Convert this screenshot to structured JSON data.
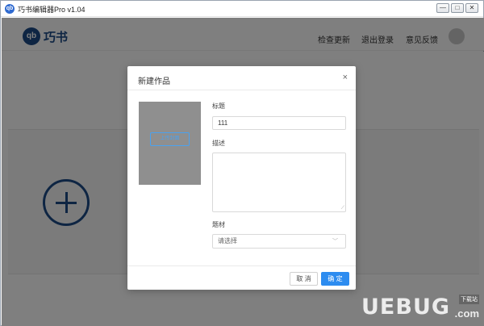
{
  "window": {
    "title": "巧书编辑器Pro v1.04",
    "app_icon_text": "qb",
    "min_glyph": "—",
    "max_glyph": "□",
    "close_glyph": "✕"
  },
  "header": {
    "logo_mark": "qb",
    "logo_text": "巧书",
    "nav": {
      "check_update": "检查更新",
      "logout": "退出登录",
      "feedback": "意见反馈"
    }
  },
  "dialog": {
    "title": "新建作品",
    "close_glyph": "×",
    "upload_label": "上传封面",
    "title_label": "标题",
    "title_value": "111",
    "description_label": "描述",
    "description_value": "",
    "genre_label": "题材",
    "genre_placeholder": "请选择",
    "cancel_label": "取 消",
    "ok_label": "确 定"
  },
  "watermark": {
    "text": "UEBUG",
    "badge": "下载站",
    "suffix": ".com"
  },
  "colors": {
    "brand": "#1c4a86",
    "primary_button": "#2d8cf0",
    "cover_placeholder": "#8f8f8f"
  },
  "icons": [
    "app-logo-icon",
    "minimize-icon",
    "maximize-icon",
    "close-icon",
    "add-circle-icon",
    "chevron-down-icon",
    "resize-grip-icon"
  ]
}
